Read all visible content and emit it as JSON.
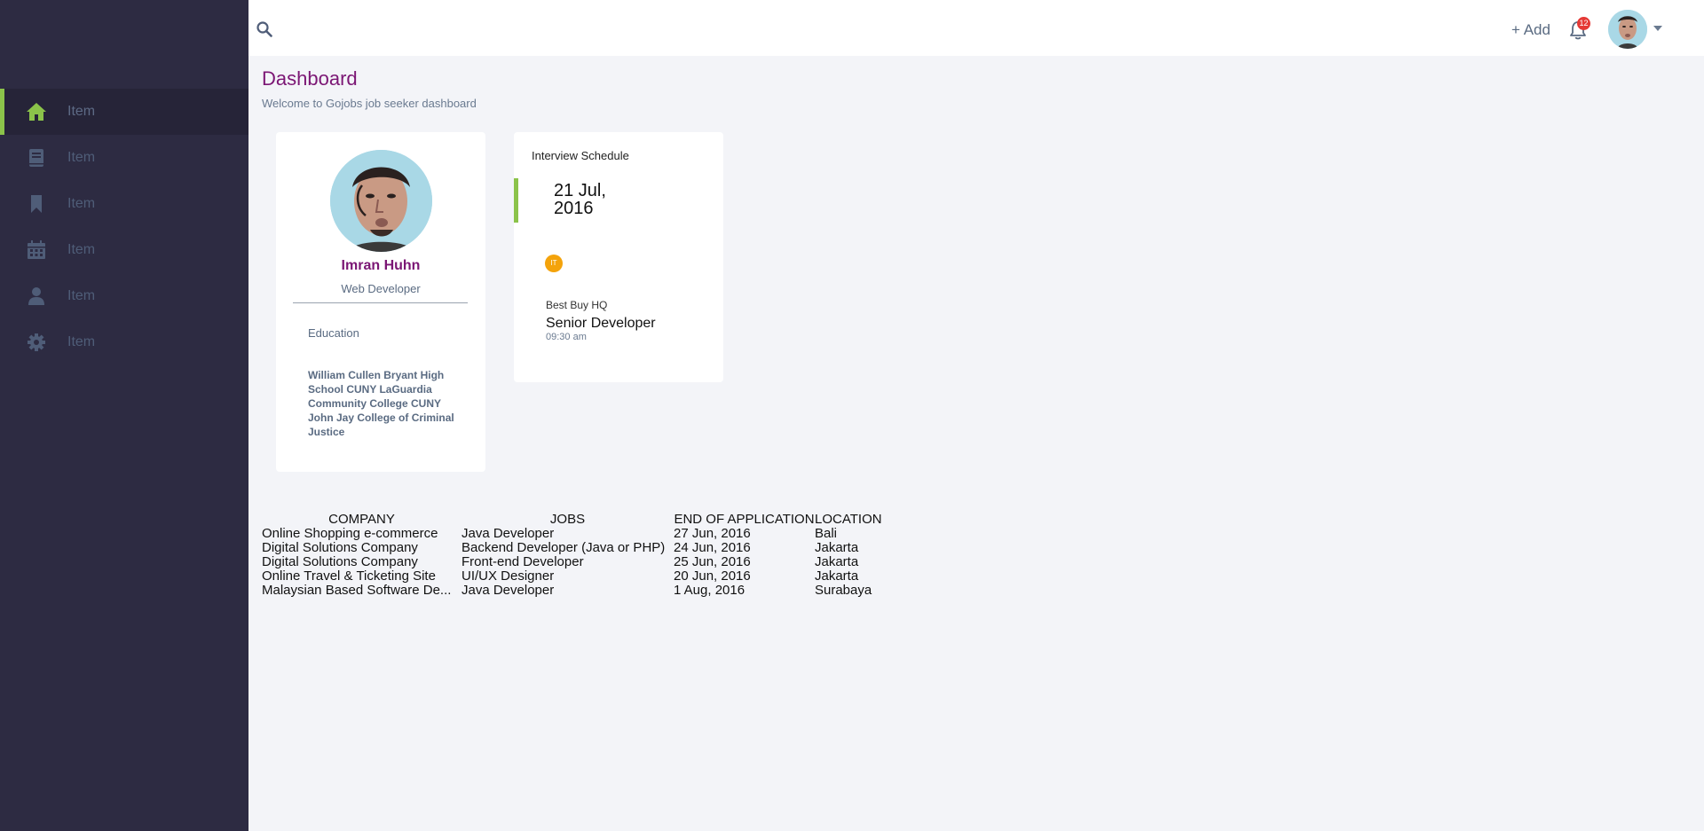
{
  "sidebar": {
    "items": [
      {
        "label": "Item",
        "icon": "home-icon",
        "active": true
      },
      {
        "label": "Item",
        "icon": "book-icon",
        "active": false
      },
      {
        "label": "Item",
        "icon": "bookmark-icon",
        "active": false
      },
      {
        "label": "Item",
        "icon": "calendar-icon",
        "active": false
      },
      {
        "label": "Item",
        "icon": "user-icon",
        "active": false
      },
      {
        "label": "Item",
        "icon": "gear-icon",
        "active": false
      }
    ]
  },
  "header": {
    "add_label": "+ Add",
    "notification_count": "12"
  },
  "page": {
    "title": "Dashboard",
    "subtitle": "Welcome to Gojobs job seeker dashboard"
  },
  "profile": {
    "name": "Imran Huhn",
    "role": "Web Developer",
    "education_label": "Education",
    "education_text": "William Cullen Bryant High School CUNY LaGuardia Community College CUNY John Jay College of Criminal Justice"
  },
  "interview": {
    "title": "Interview Schedule",
    "date": "21 Jul, 2016",
    "tag": "IT",
    "company": "Best Buy HQ",
    "position": "Senior Developer",
    "time": "09:30 am"
  },
  "jobs_table": {
    "headers": {
      "company": "COMPANY",
      "jobs": "JOBS",
      "end": "END OF APPLICATION",
      "location": "LOCATION"
    },
    "rows": [
      {
        "company": "Online Shopping e-commerce",
        "job": "Java Developer",
        "end": "27 Jun, 2016",
        "location": "Bali"
      },
      {
        "company": "Digital Solutions Company",
        "job": "Backend Developer (Java or PHP)",
        "end": "24 Jun, 2016",
        "location": "Jakarta"
      },
      {
        "company": "Digital Solutions Company",
        "job": "Front-end Developer",
        "end": "25 Jun, 2016",
        "location": "Jakarta"
      },
      {
        "company": "Online Travel & Ticketing Site",
        "job": "UI/UX Designer",
        "end": "20 Jun, 2016",
        "location": "Jakarta"
      },
      {
        "company": "Malaysian Based Software De...",
        "job": "Java Developer",
        "end": "1 Aug, 2016",
        "location": "Surabaya"
      }
    ]
  },
  "colors": {
    "sidebar_bg": "#2d2b42",
    "accent_green": "#8bc34a",
    "title_purple": "#7b1674",
    "badge_red": "#e53935",
    "tag_orange": "#f4a30b"
  }
}
